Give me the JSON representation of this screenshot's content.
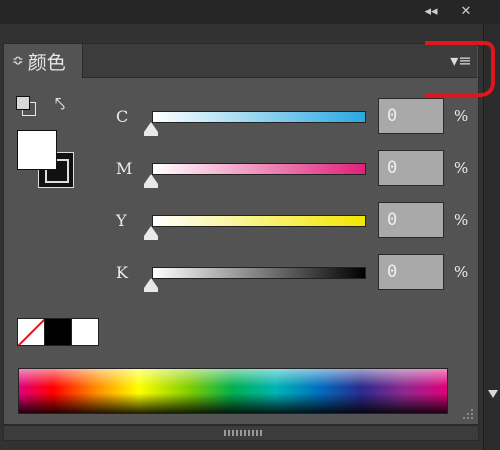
{
  "window": {
    "collapse_icon": "double-left-arrow-icon",
    "collapse_glyph": "◂◂",
    "close_icon": "close-icon",
    "close_glyph": "✕"
  },
  "panel": {
    "tab_title": "颜色",
    "tab_arrows_glyph": "≎",
    "menu_glyph": "▾≡"
  },
  "sliders": [
    {
      "label": "C",
      "value": "0",
      "unit": "%",
      "gradient": [
        "#ffffff",
        "#2aa8e0"
      ]
    },
    {
      "label": "M",
      "value": "0",
      "unit": "%",
      "gradient": [
        "#ffffff",
        "#e0207a"
      ]
    },
    {
      "label": "Y",
      "value": "0",
      "unit": "%",
      "gradient": [
        "#ffffff",
        "#f2e600"
      ]
    },
    {
      "label": "K",
      "value": "0",
      "unit": "%",
      "gradient": [
        "#ffffff",
        "#000000"
      ]
    }
  ],
  "swatches": {
    "fill_color": "#ffffff",
    "stroke_color": "#111111",
    "reset_glyph": "⤣"
  },
  "colors": {
    "panel_bg": "#535353",
    "dark_bg": "#323232",
    "annotation": "#e0161e"
  }
}
